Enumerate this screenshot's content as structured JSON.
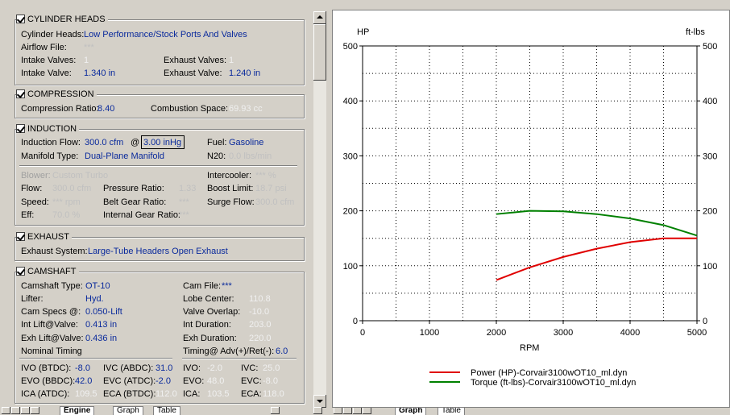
{
  "cylinder_heads": {
    "title": "CYLINDER HEADS",
    "heads_label": "Cylinder Heads:",
    "heads_value": "Low Performance/Stock Ports And Valves",
    "airflow_label": "Airflow File:",
    "airflow_value": "***",
    "intake_valves_label": "Intake Valves:",
    "intake_valves_value": "1",
    "exhaust_valves_label": "Exhaust Valves:",
    "exhaust_valves_value": "1",
    "intake_valve_label": "Intake Valve:",
    "intake_valve_value": "1.340 in",
    "exhaust_valve_label": "Exhaust Valve:",
    "exhaust_valve_value": "1.240 in"
  },
  "compression": {
    "title": "COMPRESSION",
    "ratio_label": "Compression Ratio:",
    "ratio_value": "8.40",
    "space_label": "Combustion Space:",
    "space_value": "69.93 cc"
  },
  "induction": {
    "title": "INDUCTION",
    "flow_label": "Induction Flow:",
    "flow_value": "300.0 cfm",
    "at": "@",
    "vacuum_value": "3.00 inHg",
    "fuel_label": "Fuel:",
    "fuel_value": "Gasoline",
    "manifold_label": "Manifold Type:",
    "manifold_value": "Dual-Plane Manifold",
    "n20_label": "N20:",
    "n20_value": "0.0 lbs/min",
    "blower_label": "Blower:",
    "blower_value": "Custom Turbo",
    "intercooler_label": "Intercooler:",
    "intercooler_value": "*** %",
    "bflow_label": "Flow:",
    "bflow_value": "300.0 cfm",
    "pressure_label": "Pressure Ratio:",
    "pressure_value": "1.33",
    "boost_label": "Boost Limit:",
    "boost_value": "18.7 psi",
    "speed_label": "Speed:",
    "speed_value": "*** rpm",
    "belt_label": "Belt Gear Ratio:",
    "belt_value": "***",
    "surge_label": "Surge Flow:",
    "surge_value": "300.0 cfm",
    "eff_label": "Eff:",
    "eff_value": "70.0 %",
    "internal_label": "Internal Gear Ratio:",
    "internal_value": "***"
  },
  "exhaust": {
    "title": "EXHAUST",
    "system_label": "Exhaust System:",
    "system_value": "Large-Tube Headers Open Exhaust"
  },
  "camshaft": {
    "title": "CAMSHAFT",
    "type_label": "Camshaft Type:",
    "type_value": "OT-10",
    "file_label": "Cam File:",
    "file_value": "***",
    "lifter_label": "Lifter:",
    "lifter_value": "Hyd.",
    "lobe_label": "Lobe Center:",
    "lobe_value": "110.8",
    "specs_label": "Cam Specs @:",
    "specs_value": "0.050-Lift",
    "overlap_label": "Valve Overlap:",
    "overlap_value": "-10.0",
    "int_lift_label": "Int Lift@Valve:",
    "int_lift_value": "0.413 in",
    "int_dur_label": "Int Duration:",
    "int_dur_value": "203.0",
    "exh_lift_label": "Exh Lift@Valve:",
    "exh_lift_value": "0.436 in",
    "exh_dur_label": "Exh Duration:",
    "exh_dur_value": "220.0",
    "nominal_label": "Nominal Timing",
    "timing_label": "Timing@ Adv(+)/Ret(-):",
    "timing_value": "6.0",
    "ivo1_label": "IVO (BTDC):",
    "ivo1_value": "-8.0",
    "ivc1_label": "IVC (ABDC):",
    "ivc1_value": "31.0",
    "ivo2_label": "IVO:",
    "ivo2_value": "-2.0",
    "ivc2_label": "IVC:",
    "ivc2_value": "25.0",
    "evo1_label": "EVO (BBDC):",
    "evo1_value": "42.0",
    "evc1_label": "EVC (ATDC):",
    "evc1_value": "-2.0",
    "evo2_label": "EVO:",
    "evo2_value": "48.0",
    "evc2_label": "EVC:",
    "evc2_value": "-8.0",
    "ica1_label": "ICA (ATDC):",
    "ica1_value": "109.5",
    "eca1_label": "ECA (BTDC):",
    "eca1_value": "112.0",
    "ica2_label": "ICA:",
    "ica2_value": "103.5",
    "eca2_label": "ECA:",
    "eca2_value": "118.0"
  },
  "tabs_left": [
    "Engine",
    "Graph",
    "Table"
  ],
  "tabs_right": [
    "Graph",
    "Table"
  ],
  "chart_data": {
    "type": "line",
    "xlabel": "RPM",
    "ylabel_left": "HP",
    "ylabel_right": "ft-lbs",
    "xlim": [
      0,
      5000
    ],
    "ylim": [
      0,
      500
    ],
    "x_ticks": [
      0,
      1000,
      2000,
      3000,
      4000,
      5000
    ],
    "y_ticks": [
      0,
      100,
      200,
      300,
      400,
      500
    ],
    "grid": true,
    "series": [
      {
        "name": "Power (HP)-Corvair3100wOT10_ml.dyn",
        "color": "#e00000",
        "x": [
          2000,
          2500,
          3000,
          3500,
          4000,
          4500,
          5000
        ],
        "values": [
          74,
          97,
          116,
          131,
          143,
          150,
          150
        ]
      },
      {
        "name": "Torque (ft-lbs)-Corvair3100wOT10_ml.dyn",
        "color": "#008000",
        "x": [
          2000,
          2500,
          3000,
          3500,
          4000,
          4500,
          5000
        ],
        "values": [
          194,
          200,
          199,
          194,
          186,
          174,
          155
        ]
      }
    ]
  }
}
